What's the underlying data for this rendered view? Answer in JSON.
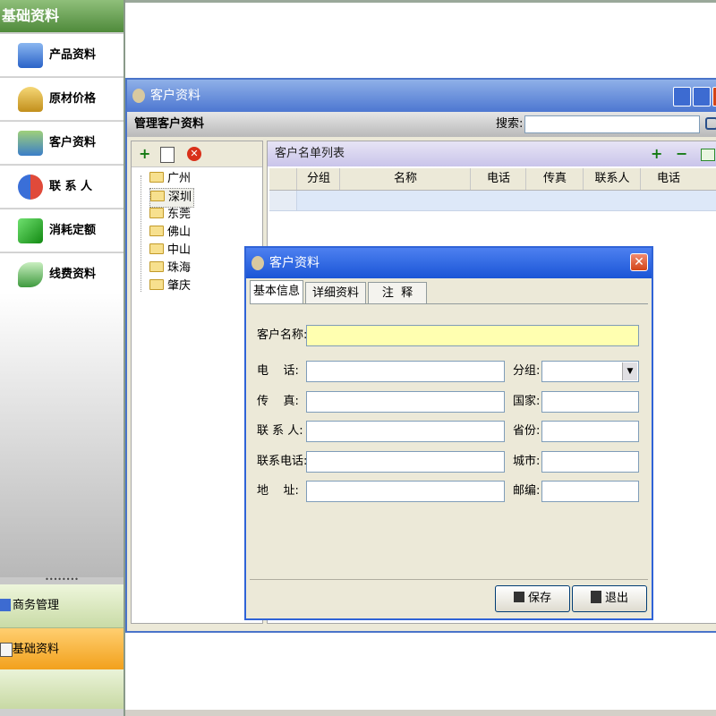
{
  "left_panel": {
    "header": "基础资料",
    "items": [
      {
        "label": "产品资料",
        "icon": "product-icon"
      },
      {
        "label": "原材价格",
        "icon": "scale-icon"
      },
      {
        "label": "客户资料",
        "icon": "customer-icon"
      },
      {
        "label": "联 系 人",
        "icon": "contacts-icon"
      },
      {
        "label": "消耗定额",
        "icon": "cube-icon"
      },
      {
        "label": "线费资料",
        "icon": "leaf-icon"
      }
    ],
    "business_mgmt": "商务管理",
    "base_data": "基础资料"
  },
  "bg_window": {
    "title": "客户资料",
    "toolbar_title": "管理客户资料",
    "search_label": "搜索:",
    "search_value": "",
    "tree": [
      "广州",
      "深圳",
      "东莞",
      "佛山",
      "中山",
      "珠海",
      "肇庆"
    ],
    "selected_tree_item": "深圳",
    "list_title": "客户名单列表",
    "columns": [
      "分组",
      "名称",
      "电话",
      "传真",
      "联系人",
      "电话"
    ]
  },
  "dialog": {
    "title": "客户资料",
    "tabs": [
      "基本信息",
      "详细资料",
      "注  释"
    ],
    "fields": {
      "name": "客户名称:",
      "phone": "电    话:",
      "fax": "传    真:",
      "contact": "联 系 人:",
      "contact_phone": "联系电话:",
      "address": "地    址:",
      "group": "分组:",
      "country": "国家:",
      "province": "省份:",
      "city": "城市:",
      "zip": "邮编:"
    },
    "save": "保存",
    "exit": "退出"
  },
  "colors": {
    "dialog_title": "#1a55d6",
    "name_field": "#ffffb0",
    "base_bar": "#f2a11c"
  }
}
